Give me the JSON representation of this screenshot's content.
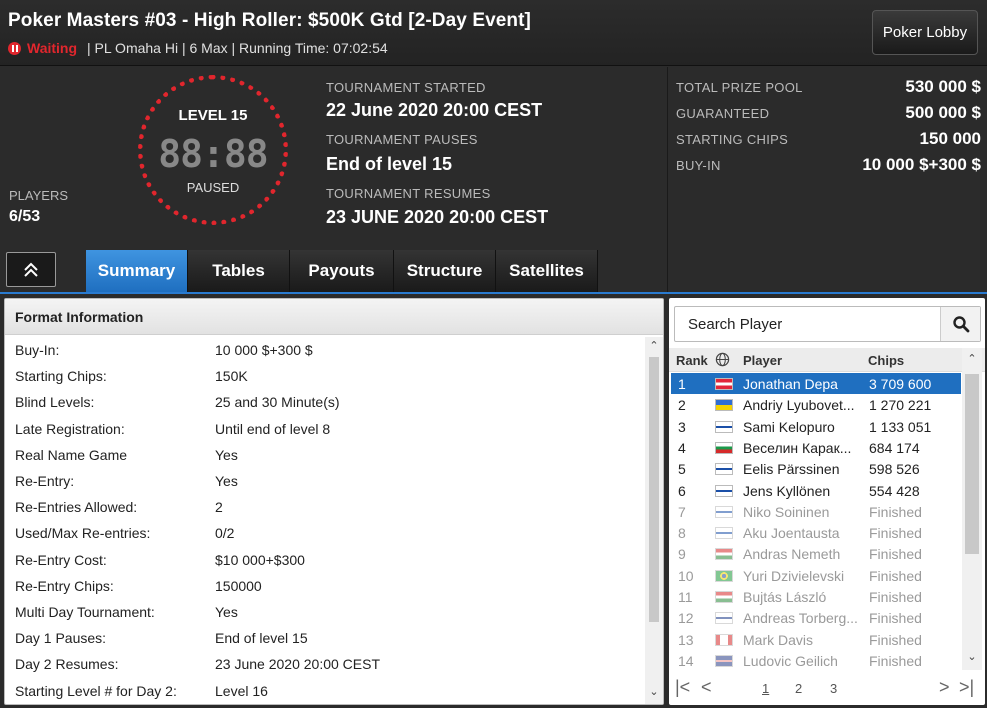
{
  "header": {
    "title": "Poker Masters #03 - High Roller: $500K Gtd [2-Day Event]",
    "status": "Waiting",
    "details": "| PL Omaha Hi | 6 Max  | Running Time: 07:02:54",
    "lobby_button": "Poker Lobby"
  },
  "level": {
    "label": "LEVEL 15",
    "clock": "88:88",
    "state": "PAUSED"
  },
  "players": {
    "label": "PLAYERS",
    "value": "6/53"
  },
  "tournament": {
    "started_label": "TOURNAMENT STARTED",
    "started_value": "22 June 2020  20:00 CEST",
    "pauses_label": "TOURNAMENT PAUSES",
    "pauses_value": "End of level 15",
    "resumes_label": "TOURNAMENT RESUMES",
    "resumes_value": "23 JUNE 2020  20:00 CEST"
  },
  "prize": [
    {
      "label": "TOTAL PRIZE POOL",
      "value": "530 000 $"
    },
    {
      "label": "GUARANTEED",
      "value": "500 000 $"
    },
    {
      "label": "STARTING CHIPS",
      "value": "150 000"
    },
    {
      "label": "BUY-IN",
      "value": "10 000 $+300 $"
    }
  ],
  "tabs": [
    "Summary",
    "Tables",
    "Payouts",
    "Structure",
    "Satellites"
  ],
  "format": {
    "title": "Format Information",
    "rows": [
      {
        "k": "Buy-In:",
        "v": "10 000 $+300 $"
      },
      {
        "k": "Starting Chips:",
        "v": "150K"
      },
      {
        "k": "Blind Levels:",
        "v": "25 and 30 Minute(s)"
      },
      {
        "k": "Late Registration:",
        "v": "Until end of level 8"
      },
      {
        "k": "Real Name Game",
        "v": "Yes"
      },
      {
        "k": "Re-Entry:",
        "v": "Yes"
      },
      {
        "k": "Re-Entries Allowed:",
        "v": "2"
      },
      {
        "k": "Used/Max Re-entries:",
        "v": "0/2"
      },
      {
        "k": "Re-Entry Cost:",
        "v": "$10 000+$300"
      },
      {
        "k": "Re-Entry Chips:",
        "v": "150000"
      },
      {
        "k": "Multi Day Tournament:",
        "v": "Yes"
      },
      {
        "k": "Day 1 Pauses:",
        "v": "End of level 15"
      },
      {
        "k": "Day 2 Resumes:",
        "v": "23 June 2020  20:00 CEST"
      },
      {
        "k": "Starting Level # for Day 2:",
        "v": "Level 16"
      }
    ]
  },
  "search": {
    "placeholder": "Search Player"
  },
  "player_table": {
    "headers": {
      "rank": "Rank",
      "player": "Player",
      "chips": "Chips"
    },
    "rows": [
      {
        "rank": "1",
        "name": "Jonathan Depa",
        "chips": "3 709 600",
        "flag": "at",
        "state": "selected"
      },
      {
        "rank": "2",
        "name": "Andriy Lyubovet...",
        "chips": "1 270 221",
        "flag": "ua",
        "state": "active"
      },
      {
        "rank": "3",
        "name": "Sami Kelopuro",
        "chips": "1 133 051",
        "flag": "fi",
        "state": "active"
      },
      {
        "rank": "4",
        "name": "Веселин Карак...",
        "chips": "684 174",
        "flag": "bg",
        "state": "active"
      },
      {
        "rank": "5",
        "name": "Eelis Pärssinen",
        "chips": "598 526",
        "flag": "fi",
        "state": "active"
      },
      {
        "rank": "6",
        "name": "Jens Kyllönen",
        "chips": "554 428",
        "flag": "fi",
        "state": "active"
      },
      {
        "rank": "7",
        "name": "Niko Soininen",
        "chips": "Finished",
        "flag": "fi",
        "state": "finished"
      },
      {
        "rank": "8",
        "name": "Aku Joentausta",
        "chips": "Finished",
        "flag": "fi",
        "state": "finished"
      },
      {
        "rank": "9",
        "name": "Andras Nemeth",
        "chips": "Finished",
        "flag": "hu",
        "state": "finished"
      },
      {
        "rank": "10",
        "name": "Yuri Dzivielevski",
        "chips": "Finished",
        "flag": "br",
        "state": "finished"
      },
      {
        "rank": "11",
        "name": "Bujtás László",
        "chips": "Finished",
        "flag": "hu",
        "state": "finished"
      },
      {
        "rank": "12",
        "name": "Andreas Torberg...",
        "chips": "Finished",
        "flag": "no",
        "state": "finished"
      },
      {
        "rank": "13",
        "name": "Mark Davis",
        "chips": "Finished",
        "flag": "ca",
        "state": "finished"
      },
      {
        "rank": "14",
        "name": "Ludovic Geilich",
        "chips": "Finished",
        "flag": "gb",
        "state": "finished"
      }
    ]
  },
  "pager": {
    "pages": [
      "1",
      "2",
      "3"
    ],
    "current": "1"
  },
  "colors": {
    "accent": "#1f6fc0",
    "danger": "#e1262d"
  }
}
